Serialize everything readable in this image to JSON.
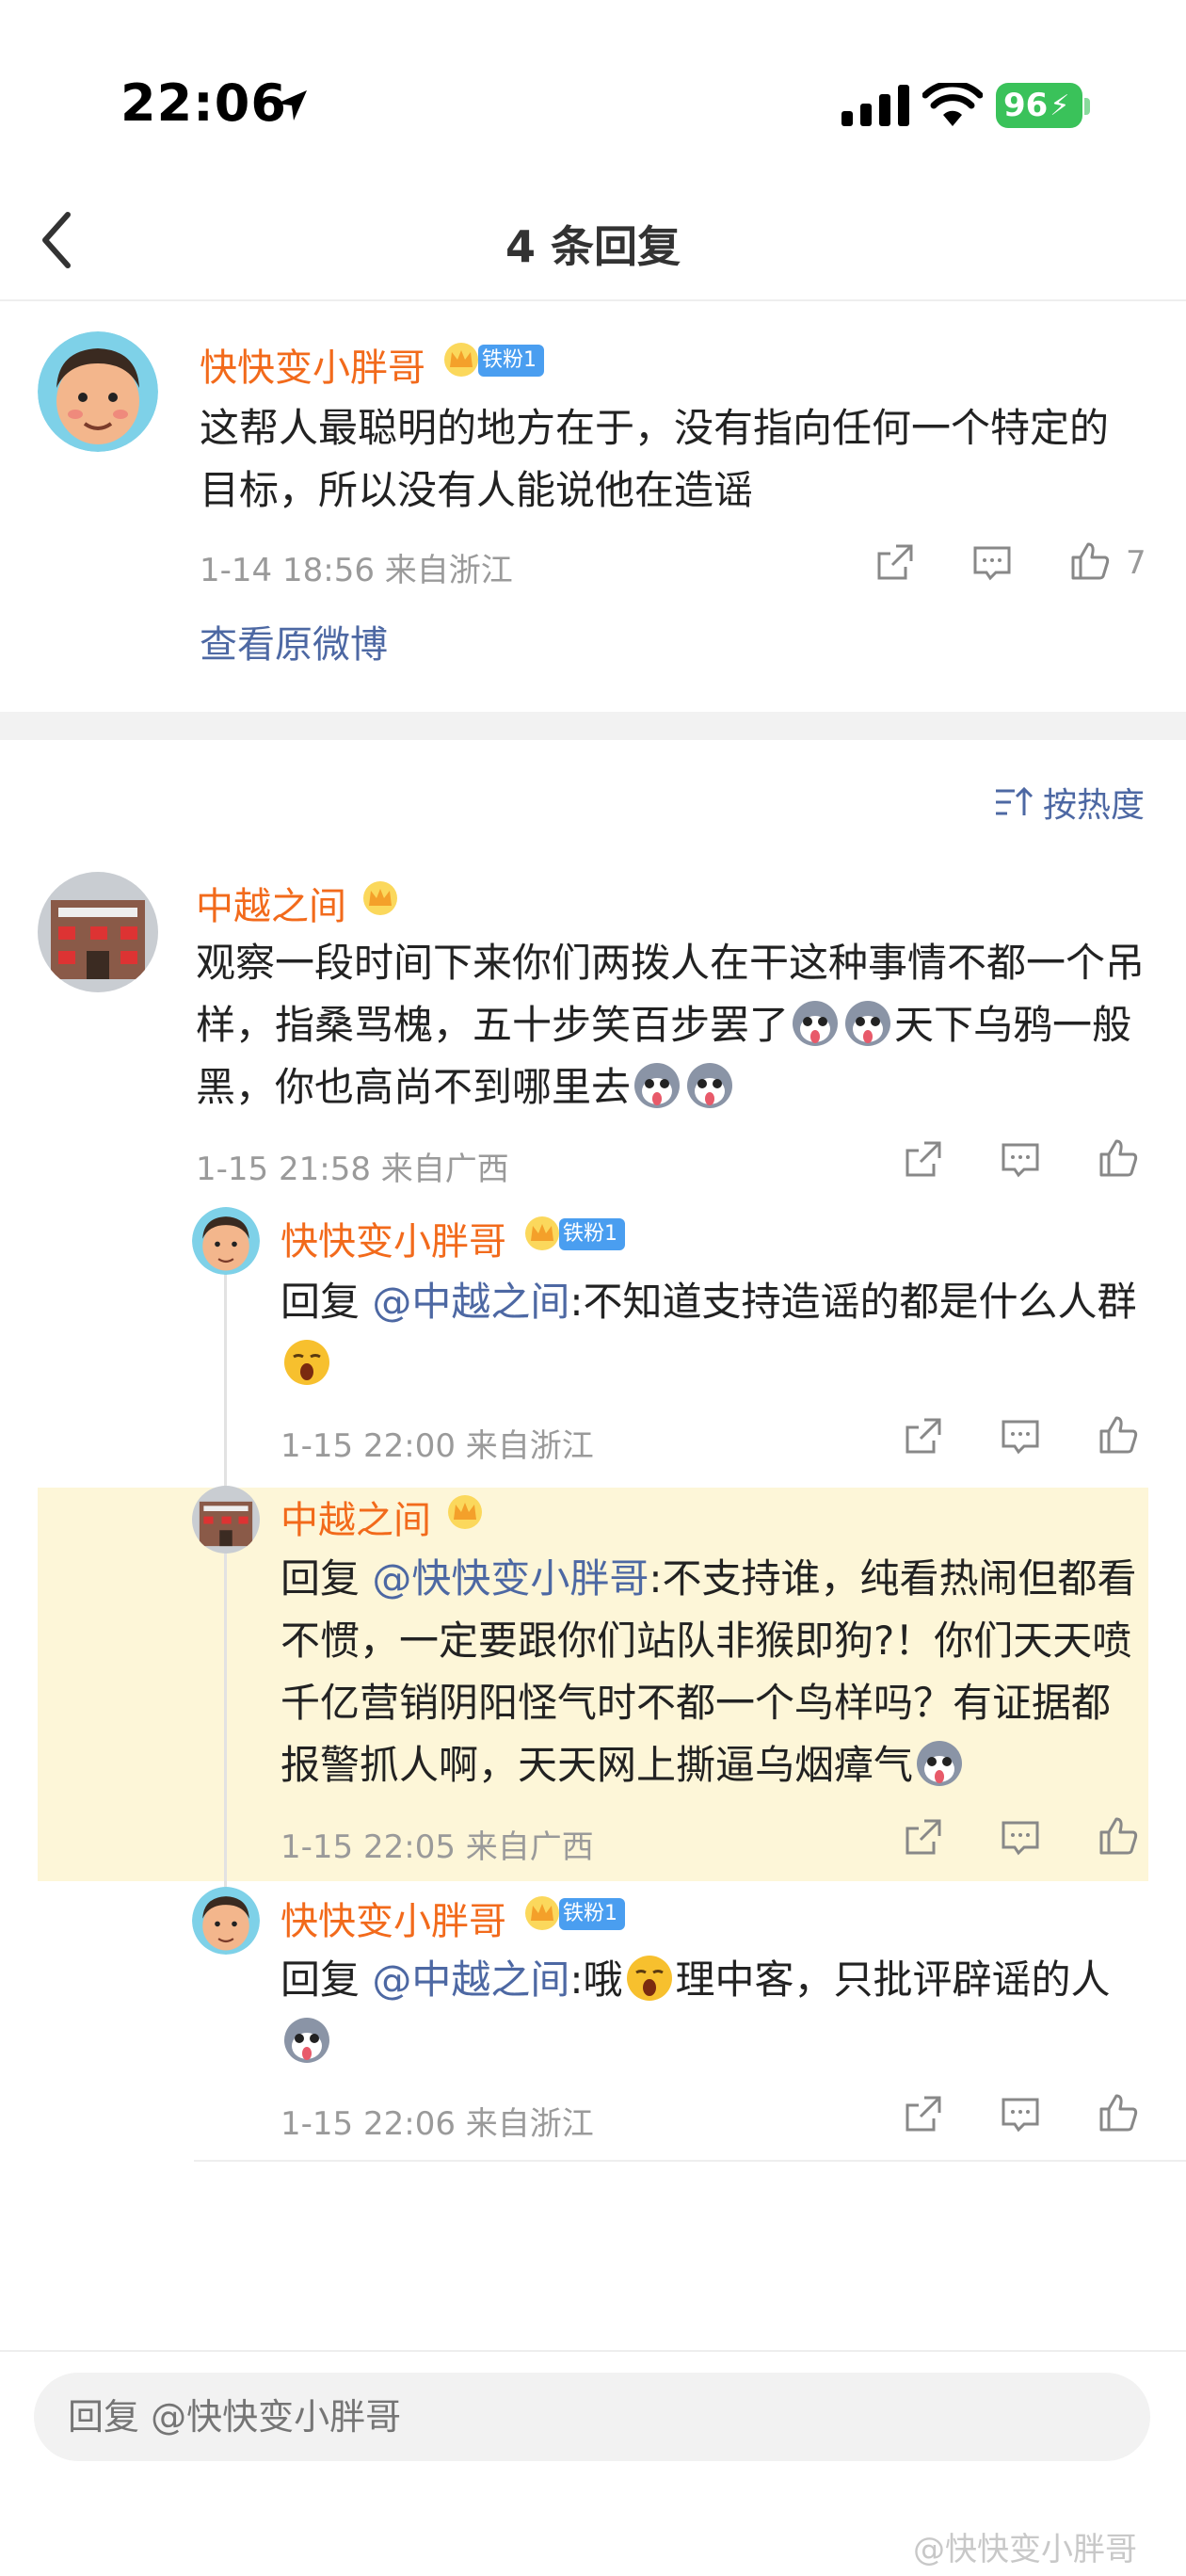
{
  "status_bar": {
    "time": "22:06",
    "battery": "96"
  },
  "nav": {
    "title": "4 条回复"
  },
  "main_post": {
    "author": "快快变小胖哥",
    "fan_badge": "铁粉1",
    "text": "这帮人最聪明的地方在于，没有指向任何一个特定的目标，所以没有人能说他在造谣",
    "time": "1-14 18:56",
    "location": "来自浙江",
    "like_count": "7",
    "view_original": "查看原微博"
  },
  "sort_label": "按热度",
  "comment": {
    "author": "中越之间",
    "text1": "观察一段时间下来你们两拨人在干这种事情不都一个吊样，指桑骂槐，五十步笑百步罢了",
    "text2": "天下乌鸦一般黑，你也高尚不到哪里去",
    "time": "1-15 21:58",
    "location": "来自广西"
  },
  "replies": [
    {
      "author": "快快变小胖哥",
      "fan_badge": "铁粉1",
      "prefix": "回复",
      "mention": "@中越之间",
      "text": ":不知道支持造谣的都是什么人群",
      "time": "1-15 22:00",
      "location": "来自浙江"
    },
    {
      "author": "中越之间",
      "prefix": "回复",
      "mention": "@快快变小胖哥",
      "text": ":不支持谁，纯看热闹但都看不惯，一定要跟你们站队非猴即狗?！你们天天喷千亿营销阴阳怪气时不都一个鸟样吗？有证据都报警抓人啊，天天网上撕逼乌烟瘴气",
      "time": "1-15 22:05",
      "location": "来自广西"
    },
    {
      "author": "快快变小胖哥",
      "fan_badge": "铁粉1",
      "prefix": "回复",
      "mention": "@中越之间",
      "text_a": ":哦",
      "text_b": "理中客，只批评辟谣的人",
      "time": "1-15 22:06",
      "location": "来自浙江"
    }
  ],
  "reply_input": {
    "placeholder": "回复 @快快变小胖哥"
  },
  "watermark": "@快快变小胖哥",
  "colors": {
    "name": "#f26a1b",
    "link": "#4d68a3",
    "highlight": "#fdf6d8",
    "badge": "#4a9ef0"
  }
}
